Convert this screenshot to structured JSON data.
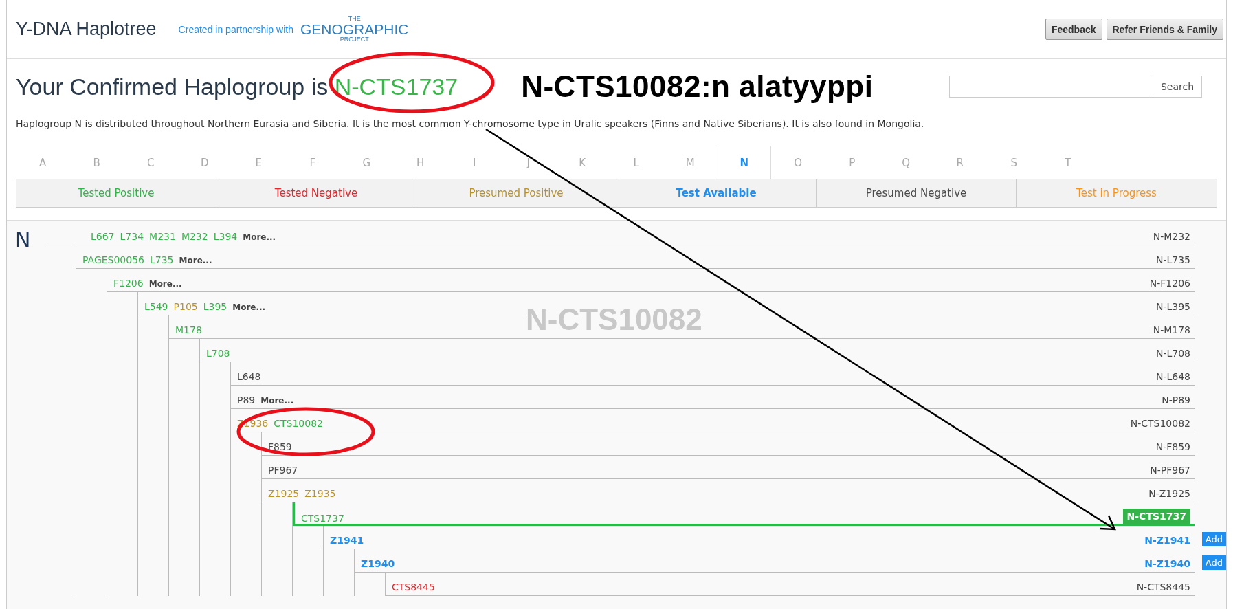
{
  "header": {
    "title": "Y-DNA Haplotree",
    "partner_text": "Created in partnership with",
    "partner_logo": {
      "top": "THE",
      "name": "GENOGRAPHIC",
      "bottom": "PROJECT"
    },
    "buttons": [
      "Feedback",
      "Refer Friends & Family"
    ]
  },
  "summary": {
    "heading": "Your Confirmed Haplogroup is",
    "haplogroup": "N-CTS1737",
    "annotation": "N-CTS10082:n alatyyppi",
    "search_button": "Search",
    "description": "Haplogroup N is distributed throughout Northern Eurasia and Siberia. It is the most common Y-chromosome type in Uralic speakers (Finns and Native Siberians). It is also found in Mongolia."
  },
  "letters": [
    {
      "label": "A",
      "selected": false
    },
    {
      "label": "B",
      "selected": false
    },
    {
      "label": "C",
      "selected": false
    },
    {
      "label": "D",
      "selected": false
    },
    {
      "label": "E",
      "selected": false
    },
    {
      "label": "F",
      "selected": false
    },
    {
      "label": "G",
      "selected": false
    },
    {
      "label": "H",
      "selected": false
    },
    {
      "label": "I",
      "selected": false
    },
    {
      "label": "J",
      "selected": false
    },
    {
      "label": "K",
      "selected": false
    },
    {
      "label": "L",
      "selected": false
    },
    {
      "label": "M",
      "selected": false
    },
    {
      "label": "N",
      "selected": true
    },
    {
      "label": "O",
      "selected": false
    },
    {
      "label": "P",
      "selected": false
    },
    {
      "label": "Q",
      "selected": false
    },
    {
      "label": "R",
      "selected": false
    },
    {
      "label": "S",
      "selected": false
    },
    {
      "label": "T",
      "selected": false
    }
  ],
  "legend": [
    {
      "label": "Tested Positive",
      "color": "#34b34a",
      "emphasized": false
    },
    {
      "label": "Tested Negative",
      "color": "#e8262b",
      "emphasized": false
    },
    {
      "label": "Presumed Positive",
      "color": "#b8922c",
      "emphasized": false
    },
    {
      "label": "Test Available",
      "color": "#1e8ff0",
      "emphasized": true
    },
    {
      "label": "Presumed Negative",
      "color": "#4a4a4a",
      "emphasized": false
    },
    {
      "label": "Test in Progress",
      "color": "#f7941d",
      "emphasized": false
    }
  ],
  "tree": {
    "root": "N",
    "overlay_text": "N-CTS10082",
    "rows": [
      {
        "markers": [
          {
            "text": "L667",
            "color": "#34b34a"
          },
          {
            "text": "L734",
            "color": "#34b34a"
          },
          {
            "text": "M231",
            "color": "#34b34a"
          },
          {
            "text": "M232",
            "color": "#34b34a"
          },
          {
            "text": "L394",
            "color": "#34b34a"
          }
        ],
        "more": "More...",
        "label": "N-M232",
        "emphasized": false,
        "current": false,
        "children": [
          {
            "markers": [
              {
                "text": "PAGES00056",
                "color": "#34b34a"
              },
              {
                "text": "L735",
                "color": "#34b34a"
              }
            ],
            "more": "More...",
            "label": "N-L735",
            "emphasized": false,
            "current": false,
            "children": [
              {
                "markers": [
                  {
                    "text": "F1206",
                    "color": "#34b34a"
                  }
                ],
                "more": "More...",
                "label": "N-F1206",
                "emphasized": false,
                "current": false,
                "children": [
                  {
                    "markers": [
                      {
                        "text": "L549",
                        "color": "#34b34a"
                      },
                      {
                        "text": "P105",
                        "color": "#b8922c"
                      },
                      {
                        "text": "L395",
                        "color": "#34b34a"
                      }
                    ],
                    "more": "More...",
                    "label": "N-L395",
                    "emphasized": false,
                    "current": false,
                    "children": [
                      {
                        "markers": [
                          {
                            "text": "M178",
                            "color": "#34b34a"
                          }
                        ],
                        "label": "N-M178",
                        "emphasized": false,
                        "current": false,
                        "children": [
                          {
                            "markers": [
                              {
                                "text": "L708",
                                "color": "#34b34a"
                              }
                            ],
                            "label": "N-L708",
                            "emphasized": false,
                            "current": false,
                            "children": [
                              {
                                "markers": [
                                  {
                                    "text": "L648",
                                    "color": "#4a4a4a"
                                  }
                                ],
                                "label": "N-L648",
                                "emphasized": false,
                                "current": false
                              },
                              {
                                "markers": [
                                  {
                                    "text": "P89",
                                    "color": "#4a4a4a"
                                  }
                                ],
                                "more": "More...",
                                "label": "N-P89",
                                "emphasized": false,
                                "current": false
                              },
                              {
                                "markers": [
                                  {
                                    "text": "Z1936",
                                    "color": "#b8922c"
                                  },
                                  {
                                    "text": "CTS10082",
                                    "color": "#34b34a"
                                  }
                                ],
                                "label": "N-CTS10082",
                                "emphasized": false,
                                "current": false,
                                "children": [
                                  {
                                    "markers": [
                                      {
                                        "text": "F859",
                                        "color": "#4a4a4a"
                                      }
                                    ],
                                    "label": "N-F859",
                                    "emphasized": false,
                                    "current": false
                                  },
                                  {
                                    "markers": [
                                      {
                                        "text": "PF967",
                                        "color": "#4a4a4a"
                                      }
                                    ],
                                    "label": "N-PF967",
                                    "emphasized": false,
                                    "current": false
                                  },
                                  {
                                    "markers": [
                                      {
                                        "text": "Z1925",
                                        "color": "#b8922c"
                                      },
                                      {
                                        "text": "Z1935",
                                        "color": "#b8922c"
                                      }
                                    ],
                                    "label": "N-Z1925",
                                    "emphasized": false,
                                    "current": false,
                                    "children": [
                                      {
                                        "markers": [
                                          {
                                            "text": "CTS1737",
                                            "color": "#34b34a"
                                          }
                                        ],
                                        "label": "N-CTS1737",
                                        "emphasized": false,
                                        "current": true,
                                        "children": [
                                          {
                                            "markers": [
                                              {
                                                "text": "Z1941",
                                                "color": "#1e8ff0"
                                              }
                                            ],
                                            "label": "N-Z1941",
                                            "emphasized": true,
                                            "current": false,
                                            "add": "Add",
                                            "children": [
                                              {
                                                "markers": [
                                                  {
                                                    "text": "Z1940",
                                                    "color": "#1e8ff0"
                                                  }
                                                ],
                                                "label": "N-Z1940",
                                                "emphasized": true,
                                                "current": false,
                                                "add": "Add",
                                                "children": [
                                                  {
                                                    "markers": [
                                                      {
                                                        "text": "CTS8445",
                                                        "color": "#e8262b"
                                                      }
                                                    ],
                                                    "label": "N-CTS8445",
                                                    "emphasized": false,
                                                    "current": false
                                                  }
                                                ]
                                              }
                                            ]
                                          }
                                        ]
                                      }
                                    ]
                                  }
                                ]
                              }
                            ]
                          }
                        ]
                      }
                    ]
                  }
                ]
              }
            ]
          }
        ]
      }
    ]
  }
}
